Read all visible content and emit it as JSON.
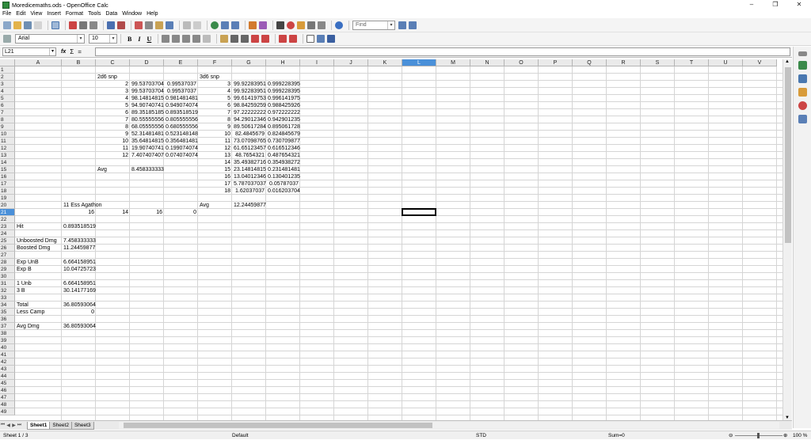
{
  "window": {
    "title": "Moredicemaths.ods - OpenOffice Calc",
    "minimize": "–",
    "maximize": "❐",
    "close": "✕"
  },
  "menu": [
    "File",
    "Edit",
    "View",
    "Insert",
    "Format",
    "Tools",
    "Data",
    "Window",
    "Help"
  ],
  "toolbar": {
    "find_placeholder": "Find",
    "font_name": "Arial",
    "font_size": "10",
    "bold": "B",
    "italic": "I",
    "underline": "U"
  },
  "formula_bar": {
    "name_box": "L21",
    "fx": "fx",
    "sum": "Σ",
    "equals": "=",
    "content": ""
  },
  "columns": [
    "A",
    "B",
    "C",
    "D",
    "E",
    "F",
    "G",
    "H",
    "I",
    "J",
    "K",
    "L",
    "M",
    "N",
    "O",
    "P",
    "Q",
    "R",
    "S",
    "T",
    "U",
    "V"
  ],
  "selected_column": "L",
  "selected_row": 21,
  "rows_visible": 49,
  "cells": [
    {
      "row": 2,
      "col": "C",
      "text": "2d6 snp",
      "align": "left"
    },
    {
      "row": 2,
      "col": "F",
      "text": "3d6 snp",
      "align": "left"
    },
    {
      "row": 3,
      "col": "C",
      "text": "2",
      "align": "right"
    },
    {
      "row": 3,
      "col": "D",
      "text": "99.53703704",
      "align": "right"
    },
    {
      "row": 3,
      "col": "E",
      "text": "0.99537037",
      "align": "right"
    },
    {
      "row": 3,
      "col": "F",
      "text": "3",
      "align": "right"
    },
    {
      "row": 3,
      "col": "G",
      "text": "99.92283951",
      "align": "right"
    },
    {
      "row": 3,
      "col": "H",
      "text": "0.999228395",
      "align": "right"
    },
    {
      "row": 4,
      "col": "C",
      "text": "3",
      "align": "right"
    },
    {
      "row": 4,
      "col": "D",
      "text": "99.53703704",
      "align": "right"
    },
    {
      "row": 4,
      "col": "E",
      "text": "0.99537037",
      "align": "right"
    },
    {
      "row": 4,
      "col": "F",
      "text": "4",
      "align": "right"
    },
    {
      "row": 4,
      "col": "G",
      "text": "99.92283951",
      "align": "right"
    },
    {
      "row": 4,
      "col": "H",
      "text": "0.999228395",
      "align": "right"
    },
    {
      "row": 5,
      "col": "C",
      "text": "4",
      "align": "right"
    },
    {
      "row": 5,
      "col": "D",
      "text": "98.14814815",
      "align": "right"
    },
    {
      "row": 5,
      "col": "E",
      "text": "0.981481481",
      "align": "right"
    },
    {
      "row": 5,
      "col": "F",
      "text": "5",
      "align": "right"
    },
    {
      "row": 5,
      "col": "G",
      "text": "99.61419753",
      "align": "right"
    },
    {
      "row": 5,
      "col": "H",
      "text": "0.996141975",
      "align": "right"
    },
    {
      "row": 6,
      "col": "C",
      "text": "5",
      "align": "right"
    },
    {
      "row": 6,
      "col": "D",
      "text": "94.90740741",
      "align": "right"
    },
    {
      "row": 6,
      "col": "E",
      "text": "0.949074074",
      "align": "right"
    },
    {
      "row": 6,
      "col": "F",
      "text": "6",
      "align": "right"
    },
    {
      "row": 6,
      "col": "G",
      "text": "98.84259259",
      "align": "right"
    },
    {
      "row": 6,
      "col": "H",
      "text": "0.988425926",
      "align": "right"
    },
    {
      "row": 7,
      "col": "C",
      "text": "6",
      "align": "right"
    },
    {
      "row": 7,
      "col": "D",
      "text": "89.35185185",
      "align": "right"
    },
    {
      "row": 7,
      "col": "E",
      "text": "0.893518519",
      "align": "right"
    },
    {
      "row": 7,
      "col": "F",
      "text": "7",
      "align": "right"
    },
    {
      "row": 7,
      "col": "G",
      "text": "97.22222222",
      "align": "right"
    },
    {
      "row": 7,
      "col": "H",
      "text": "0.972222222",
      "align": "right"
    },
    {
      "row": 8,
      "col": "C",
      "text": "7",
      "align": "right"
    },
    {
      "row": 8,
      "col": "D",
      "text": "80.55555556",
      "align": "right"
    },
    {
      "row": 8,
      "col": "E",
      "text": "0.805555556",
      "align": "right"
    },
    {
      "row": 8,
      "col": "F",
      "text": "8",
      "align": "right"
    },
    {
      "row": 8,
      "col": "G",
      "text": "94.29012346",
      "align": "right"
    },
    {
      "row": 8,
      "col": "H",
      "text": "0.942901235",
      "align": "right"
    },
    {
      "row": 9,
      "col": "C",
      "text": "8",
      "align": "right"
    },
    {
      "row": 9,
      "col": "D",
      "text": "68.05555556",
      "align": "right"
    },
    {
      "row": 9,
      "col": "E",
      "text": "0.680555556",
      "align": "right"
    },
    {
      "row": 9,
      "col": "F",
      "text": "9",
      "align": "right"
    },
    {
      "row": 9,
      "col": "G",
      "text": "89.50617284",
      "align": "right"
    },
    {
      "row": 9,
      "col": "H",
      "text": "0.895061728",
      "align": "right"
    },
    {
      "row": 10,
      "col": "C",
      "text": "9",
      "align": "right"
    },
    {
      "row": 10,
      "col": "D",
      "text": "52.31481481",
      "align": "right"
    },
    {
      "row": 10,
      "col": "E",
      "text": "0.523148148",
      "align": "right"
    },
    {
      "row": 10,
      "col": "F",
      "text": "10",
      "align": "right"
    },
    {
      "row": 10,
      "col": "G",
      "text": "82.4845679",
      "align": "right"
    },
    {
      "row": 10,
      "col": "H",
      "text": "0.824845679",
      "align": "right"
    },
    {
      "row": 11,
      "col": "C",
      "text": "10",
      "align": "right"
    },
    {
      "row": 11,
      "col": "D",
      "text": "35.64814815",
      "align": "right"
    },
    {
      "row": 11,
      "col": "E",
      "text": "0.356481481",
      "align": "right"
    },
    {
      "row": 11,
      "col": "F",
      "text": "11",
      "align": "right"
    },
    {
      "row": 11,
      "col": "G",
      "text": "73.07098765",
      "align": "right"
    },
    {
      "row": 11,
      "col": "H",
      "text": "0.730709877",
      "align": "right"
    },
    {
      "row": 12,
      "col": "C",
      "text": "11",
      "align": "right"
    },
    {
      "row": 12,
      "col": "D",
      "text": "19.90740741",
      "align": "right"
    },
    {
      "row": 12,
      "col": "E",
      "text": "0.199074074",
      "align": "right"
    },
    {
      "row": 12,
      "col": "F",
      "text": "12",
      "align": "right"
    },
    {
      "row": 12,
      "col": "G",
      "text": "61.65123457",
      "align": "right"
    },
    {
      "row": 12,
      "col": "H",
      "text": "0.616512346",
      "align": "right"
    },
    {
      "row": 13,
      "col": "C",
      "text": "12",
      "align": "right"
    },
    {
      "row": 13,
      "col": "D",
      "text": "7.407407407",
      "align": "right"
    },
    {
      "row": 13,
      "col": "E",
      "text": "0.074074074",
      "align": "right"
    },
    {
      "row": 13,
      "col": "F",
      "text": "13",
      "align": "right"
    },
    {
      "row": 13,
      "col": "G",
      "text": "48.7654321",
      "align": "right"
    },
    {
      "row": 13,
      "col": "H",
      "text": "0.487654321",
      "align": "right"
    },
    {
      "row": 14,
      "col": "F",
      "text": "14",
      "align": "right"
    },
    {
      "row": 14,
      "col": "G",
      "text": "35.49382716",
      "align": "right"
    },
    {
      "row": 14,
      "col": "H",
      "text": "0.354938272",
      "align": "right"
    },
    {
      "row": 15,
      "col": "C",
      "text": "Avg",
      "align": "left"
    },
    {
      "row": 15,
      "col": "D",
      "text": "8.458333333",
      "align": "left"
    },
    {
      "row": 15,
      "col": "F",
      "text": "15",
      "align": "right"
    },
    {
      "row": 15,
      "col": "G",
      "text": "23.14814815",
      "align": "right"
    },
    {
      "row": 15,
      "col": "H",
      "text": "0.231481481",
      "align": "right"
    },
    {
      "row": 16,
      "col": "F",
      "text": "16",
      "align": "right"
    },
    {
      "row": 16,
      "col": "G",
      "text": "13.04012346",
      "align": "right"
    },
    {
      "row": 16,
      "col": "H",
      "text": "0.130401235",
      "align": "right"
    },
    {
      "row": 17,
      "col": "F",
      "text": "17",
      "align": "right"
    },
    {
      "row": 17,
      "col": "G",
      "text": "5.787037037",
      "align": "right"
    },
    {
      "row": 17,
      "col": "H",
      "text": "0.05787037",
      "align": "right"
    },
    {
      "row": 18,
      "col": "F",
      "text": "18",
      "align": "right"
    },
    {
      "row": 18,
      "col": "G",
      "text": "1.62037037",
      "align": "right"
    },
    {
      "row": 18,
      "col": "H",
      "text": "0.016203704",
      "align": "right"
    },
    {
      "row": 20,
      "col": "B",
      "text": "11 Ess Agathon",
      "align": "left"
    },
    {
      "row": 20,
      "col": "F",
      "text": "Avg",
      "align": "left"
    },
    {
      "row": 20,
      "col": "G",
      "text": "12.24459877",
      "align": "left"
    },
    {
      "row": 21,
      "col": "B",
      "text": "16",
      "align": "right"
    },
    {
      "row": 21,
      "col": "C",
      "text": "14",
      "align": "right"
    },
    {
      "row": 21,
      "col": "D",
      "text": "16",
      "align": "right"
    },
    {
      "row": 21,
      "col": "E",
      "text": "0",
      "align": "right"
    },
    {
      "row": 23,
      "col": "A",
      "text": "Hit",
      "align": "left"
    },
    {
      "row": 23,
      "col": "B",
      "text": "0.893518519",
      "align": "left"
    },
    {
      "row": 25,
      "col": "A",
      "text": "Unboosted Dmg",
      "align": "left"
    },
    {
      "row": 25,
      "col": "B",
      "text": "7.458333333",
      "align": "left"
    },
    {
      "row": 26,
      "col": "A",
      "text": "Boosted Dmg",
      "align": "left"
    },
    {
      "row": 26,
      "col": "B",
      "text": "11.24459877",
      "align": "left"
    },
    {
      "row": 28,
      "col": "A",
      "text": "Exp UnB",
      "align": "left"
    },
    {
      "row": 28,
      "col": "B",
      "text": "6.664158951",
      "align": "left"
    },
    {
      "row": 29,
      "col": "A",
      "text": "Exp B",
      "align": "left"
    },
    {
      "row": 29,
      "col": "B",
      "text": "10.04725723",
      "align": "left"
    },
    {
      "row": 31,
      "col": "A",
      "text": "1 Unb",
      "align": "left"
    },
    {
      "row": 31,
      "col": "B",
      "text": "6.664158951",
      "align": "left"
    },
    {
      "row": 32,
      "col": "A",
      "text": "3 B",
      "align": "left"
    },
    {
      "row": 32,
      "col": "B",
      "text": "30.14177169",
      "align": "left"
    },
    {
      "row": 34,
      "col": "A",
      "text": "Total",
      "align": "left"
    },
    {
      "row": 34,
      "col": "B",
      "text": "36.80593064",
      "align": "left"
    },
    {
      "row": 35,
      "col": "A",
      "text": "Less Camp",
      "align": "left"
    },
    {
      "row": 35,
      "col": "B",
      "text": "0",
      "align": "right"
    },
    {
      "row": 37,
      "col": "A",
      "text": "Avg Dmg",
      "align": "left"
    },
    {
      "row": 37,
      "col": "B",
      "text": "36.80593064",
      "align": "left"
    }
  ],
  "sheet_tabs": [
    "Sheet1",
    "Sheet2",
    "Sheet3"
  ],
  "active_tab": "Sheet1",
  "status": {
    "sheet": "Sheet 1 / 3",
    "style": "Default",
    "mode": "STD",
    "sum": "Sum=0",
    "zoom": "100 %"
  }
}
